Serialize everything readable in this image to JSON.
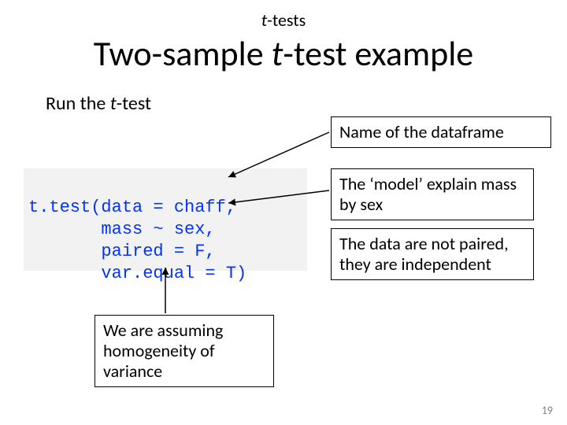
{
  "header": {
    "prefix_italic": "t",
    "prefix_rest": "-tests"
  },
  "title": {
    "part1": "Two-sample ",
    "part2_italic": "t",
    "part3": "-test example"
  },
  "subtitle": {
    "part1": "Run the ",
    "part2_italic": "t",
    "part3": "-test"
  },
  "code": {
    "line1": "t.test(data = chaff,",
    "line2": "       mass ~ sex,",
    "line3": "       paired = F,",
    "line4": "       var.equal = T)"
  },
  "annotations": {
    "dataframe": "Name of the dataframe",
    "model": "The ‘model’ explain mass by sex",
    "paired": "The data are not paired, they are independent",
    "variance": "We are assuming homogeneity of variance"
  },
  "page_number": "19"
}
